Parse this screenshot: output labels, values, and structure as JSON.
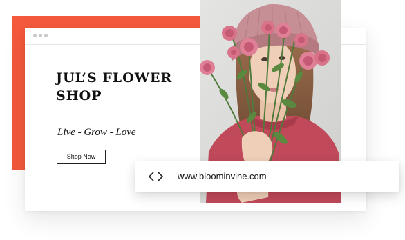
{
  "hero": {
    "title": "JUL’S FLOWER SHOP",
    "tagline": "Live - Grow - Love",
    "cta_label": "Shop Now"
  },
  "url_bar": {
    "url": "www.bloominvine.com",
    "back_icon": "chevron-left-icon",
    "forward_icon": "chevron-right-icon"
  },
  "colors": {
    "accent": "#f4593b",
    "text": "#111111",
    "sweater": "#c0495a",
    "hat": "#c68f96",
    "roses": "#d9738a"
  },
  "images": {
    "hero_photo": "woman-holding-pink-roses"
  }
}
